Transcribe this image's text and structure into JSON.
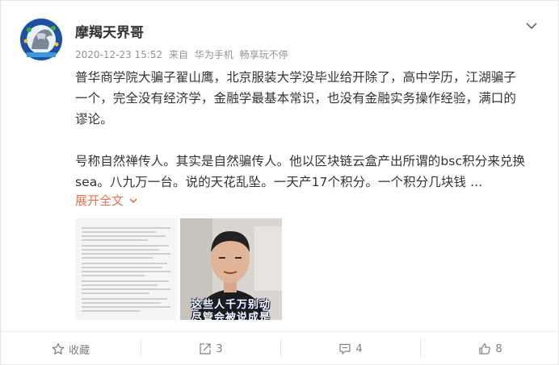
{
  "author": {
    "name": "摩羯天界哥"
  },
  "meta": {
    "timestamp": "2020-12-23 15:52",
    "source_prefix": "来自",
    "device": "华为手机",
    "extra": "畅享玩不停"
  },
  "content": {
    "paragraph1": [
      "普华商学院大骗子翟山鹰，北京服装大学没毕业给开除了，高中学历，江湖骗子",
      "一个，完全没有经济学，金融学最基本常识，也没有金融实务操作经验，满口的",
      "谬论。"
    ],
    "paragraph2": [
      "号称自然禅传人。其实是自然骗传人。他以区块链云盒产出所谓的bsc积分来兑换",
      "sea。八九万一台。说的天花乱坠。一天产17个积分。一个积分几块钱 ..."
    ],
    "expand_label": "展开全文"
  },
  "images": {
    "video_caption_line1": "这些人千万别动",
    "video_caption_line2": "尽管会被说成是"
  },
  "actions": {
    "favorite_label": "收藏",
    "repost_count": "3",
    "comment_count": "4",
    "like_count": "8"
  },
  "colors": {
    "accent": "#eb7350",
    "meta_text": "#939393",
    "action_text": "#808080"
  }
}
